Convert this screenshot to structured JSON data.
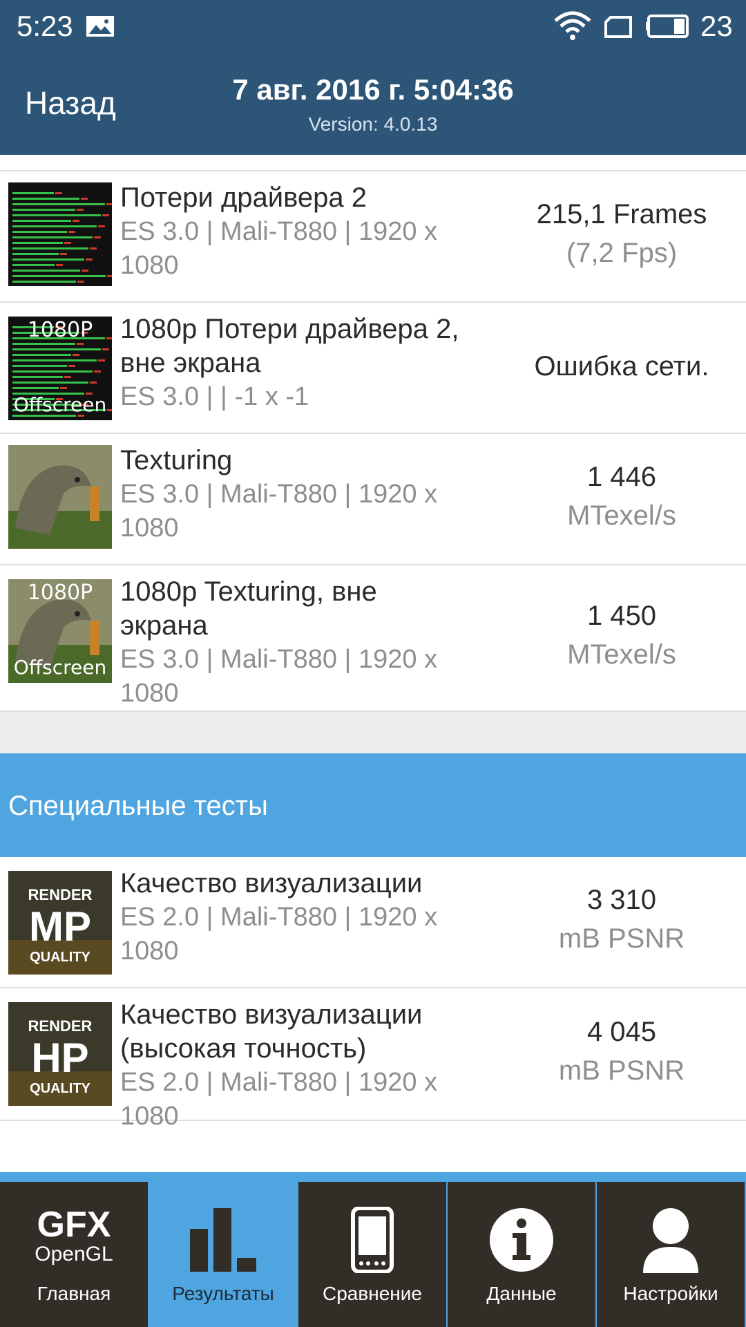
{
  "status_bar": {
    "time": "5:23",
    "battery": "23"
  },
  "header": {
    "back": "Назад",
    "title": "7 авг. 2016 г. 5:04:36",
    "version": "Version: 4.0.13"
  },
  "results": [
    {
      "name_lines": [
        "Потери драйвера 2"
      ],
      "sub_lines": [
        "ES 3.0 | Mali-T880 | 1920 x",
        "1080"
      ],
      "value_lines": [
        "215,1 Frames",
        "(7,2 Fps)"
      ],
      "thumb": "bars"
    },
    {
      "name_lines": [
        "1080p Потери драйвера 2,",
        "вне экрана"
      ],
      "sub_lines": [
        "ES 3.0 |  | -1 x -1"
      ],
      "value_lines": [
        "Ошибка сети."
      ],
      "thumb": "bars-offscreen",
      "thumb_text_top": "1080P",
      "thumb_text_bottom": "Offscreen"
    },
    {
      "name_lines": [
        "Texturing"
      ],
      "sub_lines": [
        "ES 3.0 | Mali-T880 | 1920 x",
        "1080"
      ],
      "value_lines": [
        "1 446",
        "MTexel/s"
      ],
      "thumb": "dino"
    },
    {
      "name_lines": [
        "1080p Texturing, вне",
        "экрана"
      ],
      "sub_lines": [
        "ES 3.0 | Mali-T880 | 1920 x",
        "1080"
      ],
      "value_lines": [
        "1 450",
        "MTexel/s"
      ],
      "thumb": "dino-offscreen",
      "thumb_text_top": "1080P",
      "thumb_text_bottom": "Offscreen"
    }
  ],
  "section_title": "Специальные тесты",
  "special": [
    {
      "name_lines": [
        "Качество визуализации"
      ],
      "sub_lines": [
        "ES 2.0 | Mali-T880 | 1920 x",
        "1080"
      ],
      "value_lines": [
        "3 310",
        "mB PSNR"
      ],
      "thumb": "render",
      "thumb_text_top": "RENDER",
      "thumb_text_mid": "MP",
      "thumb_text_bottom": "QUALITY"
    },
    {
      "name_lines": [
        "Качество визуализации",
        "(высокая точность)"
      ],
      "sub_lines": [
        "ES 2.0 | Mali-T880 | 1920 x",
        "1080"
      ],
      "value_lines": [
        "4 045",
        "mB PSNR"
      ],
      "thumb": "render",
      "thumb_text_top": "RENDER",
      "thumb_text_mid": "HP",
      "thumb_text_bottom": "QUALITY"
    }
  ],
  "nav": {
    "gfx_line1": "GFX",
    "gfx_line2": "OpenGL",
    "items": [
      {
        "label": "Главная",
        "icon": "gfx-logo",
        "active": false
      },
      {
        "label": "Результаты",
        "icon": "bar-chart-icon",
        "active": true
      },
      {
        "label": "Сравнение",
        "icon": "phone-icon",
        "active": false
      },
      {
        "label": "Данные",
        "icon": "info-icon",
        "active": false
      },
      {
        "label": "Настройки",
        "icon": "user-icon",
        "active": false
      }
    ]
  }
}
